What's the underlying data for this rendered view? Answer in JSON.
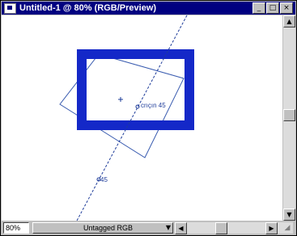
{
  "window": {
    "title": "Untitled-1 @ 80% (RGB/Preview)",
    "controls": {
      "minimize": "_",
      "maximize": "□",
      "close": "×"
    }
  },
  "canvas": {
    "shape_color": "#1428c8",
    "guide_color": "#1e3c9a",
    "labels": {
      "guide_label": "crıçın 45",
      "bottom_label": "45"
    }
  },
  "scrollbars": {
    "vertical": {
      "up": "▲",
      "down": "▼"
    },
    "horizontal": {
      "left": "◀",
      "right": "▶"
    }
  },
  "statusbar": {
    "zoom": "80%",
    "profile": "Untagged RGB",
    "dropdown_arrow": "▼",
    "grip": "◢"
  }
}
